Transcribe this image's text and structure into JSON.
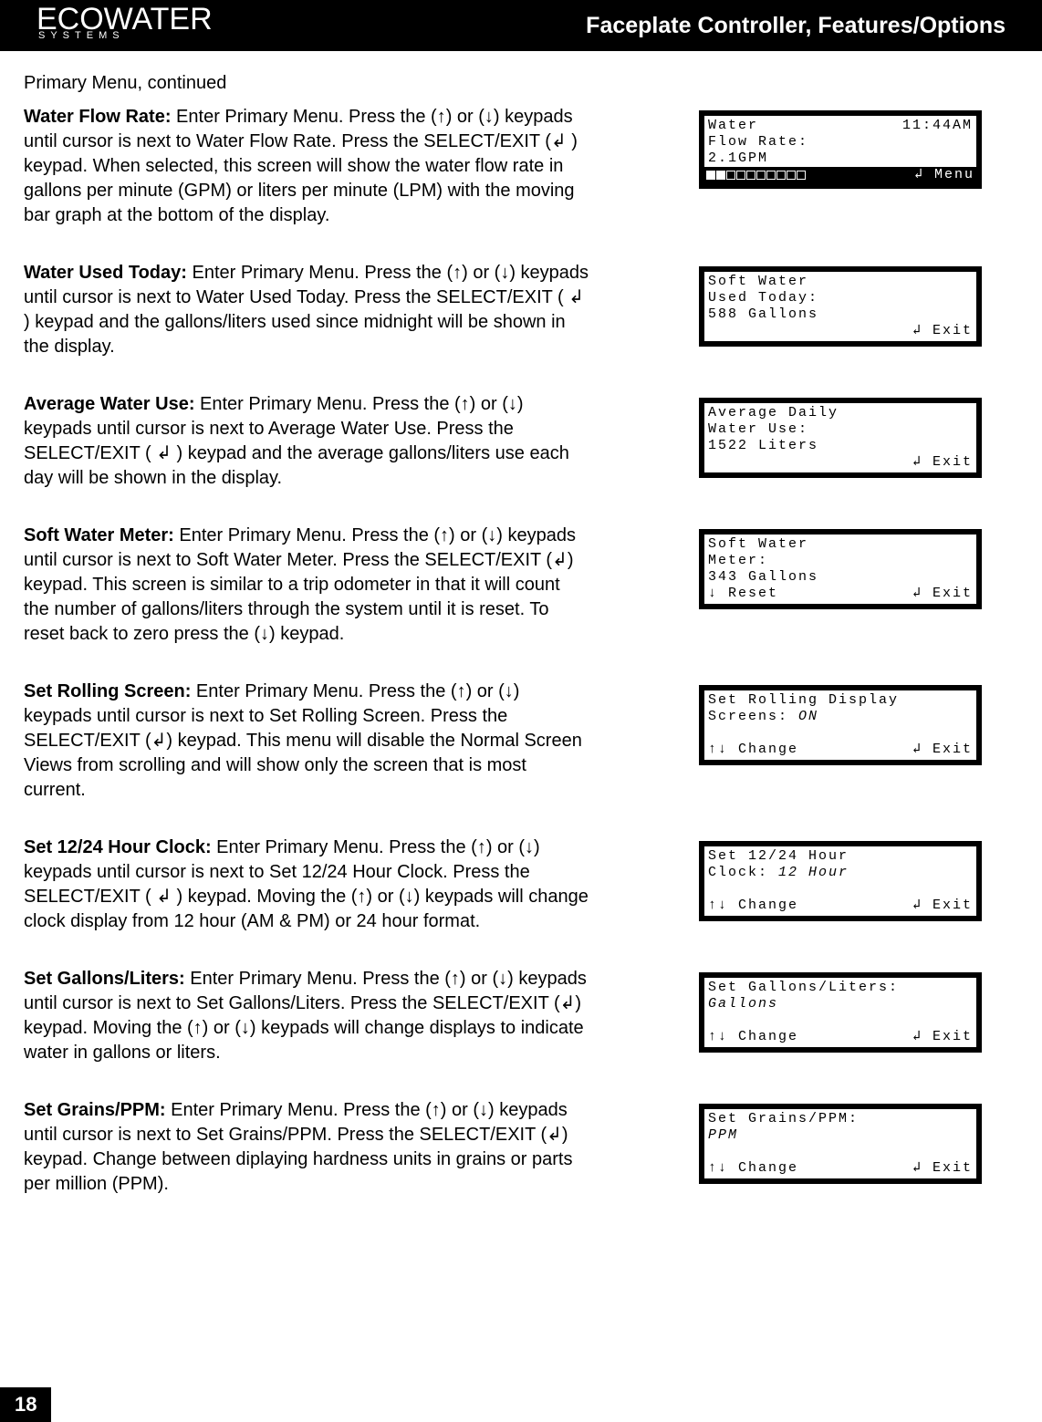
{
  "header": {
    "logo_main": "ECOWATER",
    "logo_sub": "SYSTEMS",
    "title": "Faceplate Controller, Features/Options"
  },
  "subhead": "Primary Menu, continued",
  "sections": [
    {
      "title": "Water Flow Rate:",
      "body": " Enter Primary Menu. Press the (↑) or (↓) keypads until cursor is next to Water Flow Rate. Press the SELECT/EXIT (↲ ) keypad.  When selected, this screen will show the water flow rate in gallons per minute (GPM) or liters per minute (LPM) with the moving bar graph at the bottom of the display.",
      "lcd": {
        "type": "flowrate",
        "l1a": "Water",
        "l1b": "11:44AM",
        "l2": "Flow Rate:",
        "l3": "2.1GPM",
        "menu": "↲ Menu"
      }
    },
    {
      "title": "Water Used Today:",
      "body": " Enter Primary Menu. Press the (↑) or (↓) keypads until cursor is next to Water Used Today.   Press the SELECT/EXIT ( ↲ ) keypad and the gallons/liters used since midnight will be shown in the display.",
      "lcd": {
        "type": "plain4",
        "l1": "Soft Water",
        "l2": "Used Today:",
        "l3": "588 Gallons",
        "l4r": "↲ Exit"
      }
    },
    {
      "title": "Average Water Use:",
      "body": " Enter Primary Menu. Press the (↑) or (↓) keypads until cursor is next to Average Water Use.   Press the SELECT/EXIT ( ↲ ) keypad and the average gallons/liters use each day will be shown in the display.",
      "lcd": {
        "type": "plain4",
        "l1": "Average Daily",
        "l2": "Water Use:",
        "l3": "1522 Liters",
        "l4r": "↲ Exit"
      }
    },
    {
      "title": "Soft Water Meter:",
      "body": " Enter Primary Menu. Press the (↑) or (↓) keypads until cursor is next to Soft Water Meter.  Press the SELECT/EXIT (↲) keypad.  This screen is similar to a trip odometer in that it will count the number of gallons/liters through the system until it is reset. To reset back to zero press the (↓) keypad.",
      "lcd": {
        "type": "split4",
        "l1": "Soft Water",
        "l2": "Meter:",
        "l3": "343 Gallons",
        "l4a": "↓ Reset",
        "l4b": "↲ Exit"
      }
    },
    {
      "title": "Set Rolling Screen:",
      "body": " Enter Primary Menu. Press the (↑) or (↓) keypads until cursor is next to Set Rolling Screen.  Press the SELECT/EXIT (↲) keypad.   This menu will disable the Normal Screen Views from scrolling and will show only the screen that is most current.",
      "lcd": {
        "type": "twoline",
        "l1": "Set Rolling Display",
        "l2a": "Screens: ",
        "l2ital": "ON",
        "b1": "↑↓ Change",
        "b2": "↲ Exit"
      }
    },
    {
      "title": "Set 12/24 Hour Clock:",
      "body": " Enter Primary Menu. Press the (↑) or (↓) keypads until cursor is next to Set 12/24 Hour Clock.  Press the SELECT/EXIT ( ↲ ) keypad.  Moving the (↑) or (↓) keypads will change clock display from 12 hour (AM & PM) or 24 hour format.",
      "lcd": {
        "type": "twoline",
        "l1": "Set 12/24 Hour",
        "l2a": "Clock: ",
        "l2ital": "12 Hour",
        "b1": "↑↓ Change",
        "b2": "↲ Exit"
      }
    },
    {
      "title": "Set Gallons/Liters:",
      "body": " Enter Primary Menu. Press the (↑) or (↓) keypads until cursor is next to Set Gallons/Liters.  Press the SELECT/EXIT (↲) keypad. Moving the (↑) or (↓) keypads will change displays to indicate water in gallons or liters.",
      "lcd": {
        "type": "twoline",
        "l1": "Set Gallons/Liters:",
        "l2a": "",
        "l2ital": "Gallons",
        "b1": "↑↓ Change",
        "b2": "↲ Exit"
      }
    },
    {
      "title": "Set Grains/PPM:",
      "body": " Enter Primary Menu. Press the (↑) or (↓) keypads until cursor is next to Set Grains/PPM.  Press the SELECT/EXIT (↲) keypad. Change between diplaying hardness units in grains or parts per million (PPM).",
      "lcd": {
        "type": "twoline",
        "l1": "Set Grains/PPM:",
        "l2a": "",
        "l2ital": "PPM",
        "b1": "↑↓ Change",
        "b2": "↲ Exit"
      }
    }
  ],
  "page_number": "18"
}
